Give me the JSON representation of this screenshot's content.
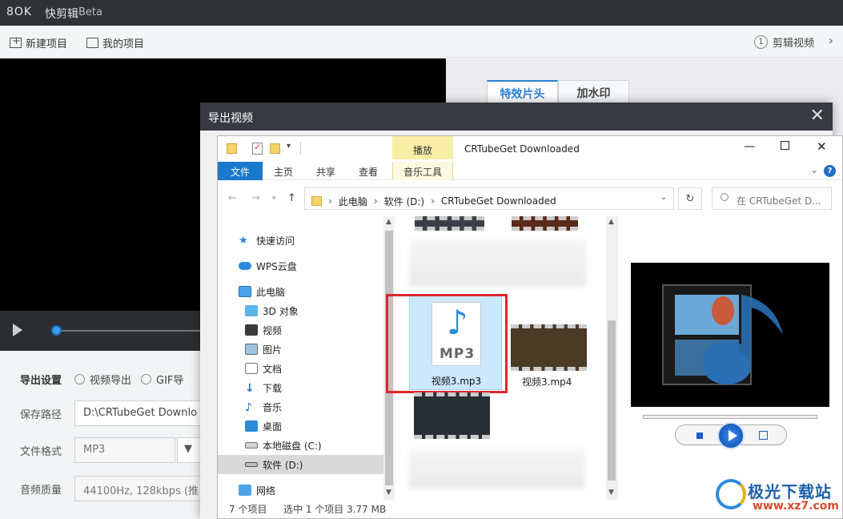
{
  "app": {
    "logo": "8OK",
    "name": "快剪辑",
    "beta": "Beta",
    "menu": {
      "new_project": "新建项目",
      "my_projects": "我的项目"
    },
    "step": {
      "num": "1",
      "label": "剪辑视频"
    },
    "tabs": [
      "特效片头",
      "加水印"
    ],
    "export": {
      "settings_label": "导出设置",
      "opt_video": "视频导出",
      "opt_gif": "GIF导",
      "path_label": "保存路径",
      "path_value": "D:\\CRTubeGet Downlo",
      "format_label": "文件格式",
      "format_value": "MP3",
      "quality_label": "音频质量",
      "quality_value": "44100Hz, 128kbps (推"
    }
  },
  "dialog": {
    "title": "导出视频"
  },
  "explorer": {
    "ctx_tab": "播放",
    "window_title": "CRTubeGet Downloaded",
    "ribbon": {
      "file": "文件",
      "home": "主页",
      "share": "共享",
      "view": "查看",
      "music_tools": "音乐工具"
    },
    "address": {
      "segments": [
        "此电脑",
        "软件 (D:)",
        "CRTubeGet Downloaded"
      ]
    },
    "search_placeholder": "在 CRTubeGet D...",
    "nav": {
      "quick": "快速访问",
      "wps": "WPS云盘",
      "pc": "此电脑",
      "obj3d": "3D 对象",
      "video": "视频",
      "pics": "图片",
      "docs": "文档",
      "downloads": "下载",
      "music": "音乐",
      "desktop": "桌面",
      "disk_c": "本地磁盘 (C:)",
      "disk_d": "软件 (D:)",
      "network": "网络"
    },
    "files": {
      "mp3_name": "视频3.mp3",
      "mp3_label": "MP3",
      "mp4_name": "视频3.mp4"
    },
    "status": {
      "count": "7 个项目",
      "selected": "选中 1 个项目  3.77 MB"
    }
  },
  "watermark": {
    "text": "极光下载站",
    "url": "www.xz7.com"
  },
  "colors": {
    "accent": "#2b7fd8",
    "highlight": "#e0262b",
    "file_tab": "#1979ca"
  }
}
